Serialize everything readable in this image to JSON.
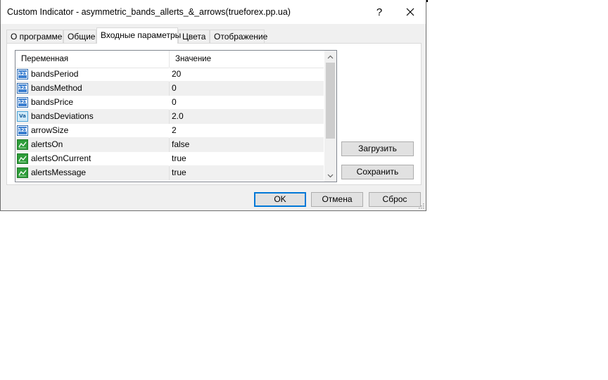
{
  "window": {
    "title": "Custom Indicator - asymmetric_bands_allerts_&_arrows(trueforex.pp.ua)",
    "help_label": "?"
  },
  "tabs": [
    {
      "label": "О программе",
      "active": false
    },
    {
      "label": "Общие",
      "active": false
    },
    {
      "label": "Входные параметры",
      "active": true
    },
    {
      "label": "Цвета",
      "active": false
    },
    {
      "label": "Отображение",
      "active": false
    }
  ],
  "grid": {
    "col_variable": "Переменная",
    "col_value": "Значение",
    "rows": [
      {
        "type": "int",
        "icon_text": "123",
        "name": "bandsPeriod",
        "value": "20"
      },
      {
        "type": "int",
        "icon_text": "123",
        "name": "bandsMethod",
        "value": "0"
      },
      {
        "type": "int",
        "icon_text": "123",
        "name": "bandsPrice",
        "value": "0"
      },
      {
        "type": "double",
        "icon_text": "Va",
        "name": "bandsDeviations",
        "value": "2.0"
      },
      {
        "type": "int",
        "icon_text": "123",
        "name": "arrowSize",
        "value": "2"
      },
      {
        "type": "bool",
        "icon_text": "",
        "name": "alertsOn",
        "value": "false"
      },
      {
        "type": "bool",
        "icon_text": "",
        "name": "alertsOnCurrent",
        "value": "true"
      },
      {
        "type": "bool",
        "icon_text": "",
        "name": "alertsMessage",
        "value": "true"
      }
    ]
  },
  "side_buttons": {
    "load": "Загрузить",
    "save": "Сохранить"
  },
  "footer_buttons": {
    "ok": "OK",
    "cancel": "Отмена",
    "reset": "Сброс"
  },
  "colors": {
    "accent": "#0078d7",
    "dialog_bg": "#f0f0f0",
    "bool_icon": "#2e9d3a",
    "int_icon": "#3b7fd0"
  }
}
